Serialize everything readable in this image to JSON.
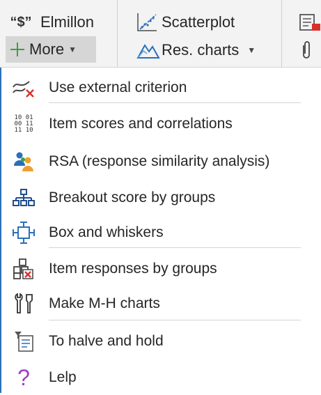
{
  "ribbon": {
    "elmillon_label": "Elmillon",
    "scatterplot_label": "Scatterplot",
    "more_label": "More",
    "res_charts_label": "Res. charts",
    "quote_glyph": "“$”",
    "accent": "#2b6fb8"
  },
  "menu": {
    "items": [
      {
        "label": "Use external criterion",
        "icon": "external-criterion-icon"
      },
      {
        "label": "Item scores and correlations",
        "icon": "item-scores-icon"
      },
      {
        "label": "RSA (response similarity analysis)",
        "icon": "rsa-icon"
      },
      {
        "label": "Breakout score by groups",
        "icon": "breakout-icon"
      },
      {
        "label": "Box and whiskers",
        "icon": "box-whiskers-icon"
      },
      {
        "label": "Item responses by groups",
        "icon": "item-responses-icon"
      },
      {
        "label": "Make M-H charts",
        "icon": "mh-charts-icon"
      },
      {
        "label": "To halve and hold",
        "icon": "halve-hold-icon"
      },
      {
        "label": "Lelp",
        "icon": "help-icon"
      }
    ],
    "item_scores_digits": [
      "10 01",
      "00 11",
      "11 10"
    ]
  }
}
